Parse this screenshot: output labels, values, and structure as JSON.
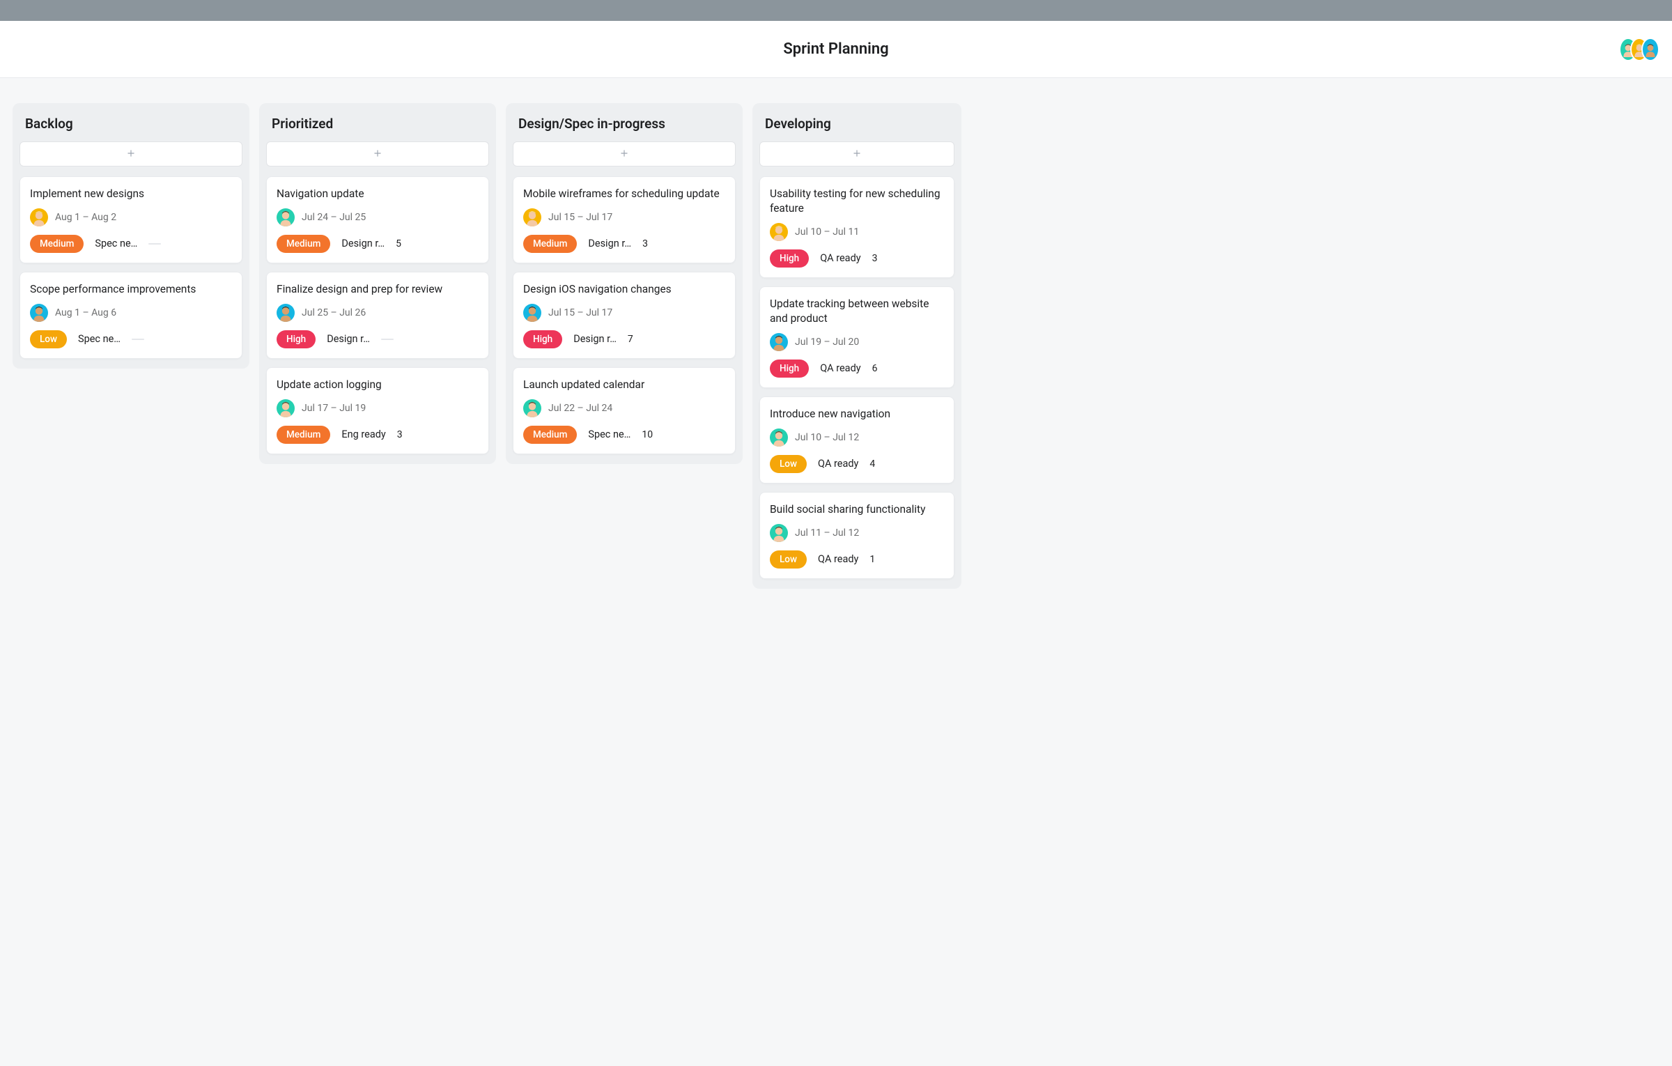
{
  "header": {
    "title": "Sprint Planning",
    "members": [
      {
        "avatar": "green"
      },
      {
        "avatar": "yellow"
      },
      {
        "avatar": "blue"
      }
    ]
  },
  "priority_labels": {
    "high": "High",
    "medium": "Medium",
    "low": "Low"
  },
  "columns": [
    {
      "title": "Backlog",
      "cards": [
        {
          "title": "Implement new designs",
          "assignee": "yellow",
          "dates": "Aug 1 – Aug 2",
          "priority": "medium",
          "status": "Spec ne…",
          "count": null,
          "dash": true
        },
        {
          "title": "Scope performance improvements",
          "assignee": "blue",
          "dates": "Aug 1 – Aug 6",
          "priority": "low",
          "status": "Spec ne…",
          "count": null,
          "dash": true
        }
      ]
    },
    {
      "title": "Prioritized",
      "cards": [
        {
          "title": "Navigation update",
          "assignee": "green",
          "dates": "Jul 24 – Jul 25",
          "priority": "medium",
          "status": "Design r…",
          "count": "5",
          "dash": false
        },
        {
          "title": "Finalize design and prep for review",
          "assignee": "blue",
          "dates": "Jul 25 – Jul 26",
          "priority": "high",
          "status": "Design r…",
          "count": null,
          "dash": true
        },
        {
          "title": "Update action logging",
          "assignee": "green",
          "dates": "Jul 17 – Jul 19",
          "priority": "medium",
          "status": "Eng ready",
          "count": "3",
          "dash": false
        }
      ]
    },
    {
      "title": "Design/Spec in-progress",
      "cards": [
        {
          "title": "Mobile wireframes for scheduling update",
          "assignee": "yellow",
          "dates": "Jul 15 – Jul 17",
          "priority": "medium",
          "status": "Design r…",
          "count": "3",
          "dash": false
        },
        {
          "title": "Design iOS navigation changes",
          "assignee": "blue",
          "dates": "Jul 15 – Jul 17",
          "priority": "high",
          "status": "Design r…",
          "count": "7",
          "dash": false
        },
        {
          "title": "Launch updated calendar",
          "assignee": "green",
          "dates": "Jul 22 – Jul 24",
          "priority": "medium",
          "status": "Spec ne…",
          "count": "10",
          "dash": false
        }
      ]
    },
    {
      "title": "Developing",
      "cards": [
        {
          "title": "Usability testing for new scheduling feature",
          "assignee": "yellow",
          "dates": "Jul 10 – Jul 11",
          "priority": "high",
          "status": "QA ready",
          "count": "3",
          "dash": false
        },
        {
          "title": "Update tracking between website and product",
          "assignee": "blue",
          "dates": "Jul 19 – Jul 20",
          "priority": "high",
          "status": "QA ready",
          "count": "6",
          "dash": false
        },
        {
          "title": "Introduce new navigation",
          "assignee": "green",
          "dates": "Jul 10 – Jul 12",
          "priority": "low",
          "status": "QA ready",
          "count": "4",
          "dash": false
        },
        {
          "title": "Build social sharing functionality",
          "assignee": "green",
          "dates": "Jul 11 – Jul 12",
          "priority": "low",
          "status": "QA ready",
          "count": "1",
          "dash": false
        }
      ]
    }
  ]
}
